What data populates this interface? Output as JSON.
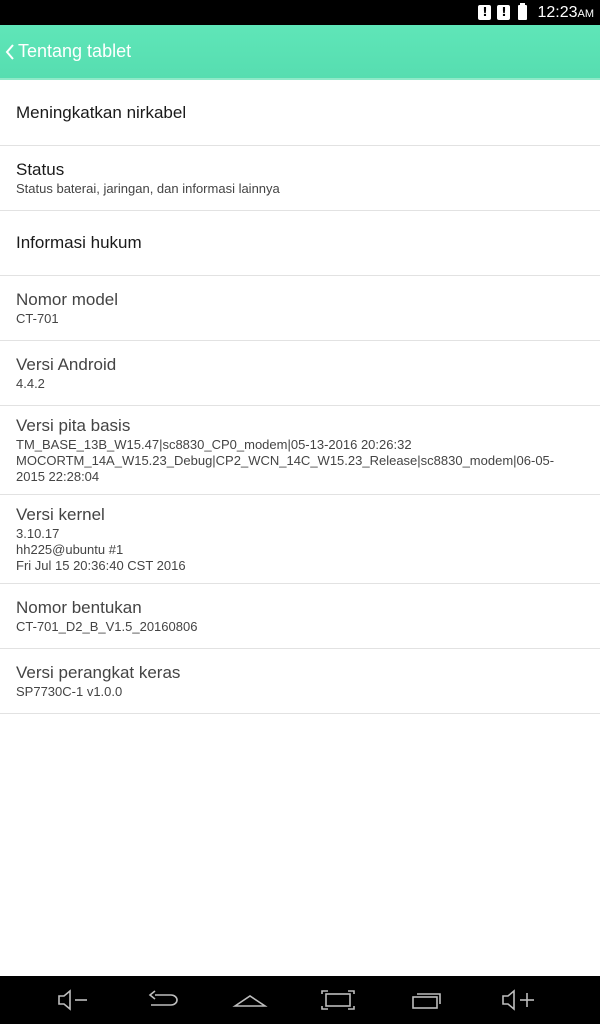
{
  "status_bar": {
    "notifications": [
      "!",
      "!"
    ],
    "time": "12:23",
    "ampm": "AM"
  },
  "action_bar": {
    "title": "Tentang tablet",
    "background": "#5fe6b8"
  },
  "items": [
    {
      "title": "Meningkatkan nirkabel",
      "subtitle": ""
    },
    {
      "title": "Status",
      "subtitle": "Status baterai, jaringan, dan informasi lainnya"
    },
    {
      "title": "Informasi hukum",
      "subtitle": ""
    },
    {
      "title": "Nomor model",
      "subtitle": "CT-701"
    },
    {
      "title": "Versi Android",
      "subtitle": "4.4.2"
    },
    {
      "title": "Versi pita basis",
      "subtitle": "TM_BASE_13B_W15.47|sc8830_CP0_modem|05-13-2016 20:26:32\nMOCORTM_14A_W15.23_Debug|CP2_WCN_14C_W15.23_Release|sc8830_modem|06-05-2015 22:28:04"
    },
    {
      "title": "Versi kernel",
      "subtitle": "3.10.17\nhh225@ubuntu #1\nFri Jul 15 20:36:40 CST 2016"
    },
    {
      "title": "Nomor bentukan",
      "subtitle": "CT-701_D2_B_V1.5_20160806"
    },
    {
      "title": "Versi perangkat keras",
      "subtitle": "SP7730C-1 v1.0.0"
    }
  ],
  "nav_bar": {
    "buttons": [
      "volume-down-icon",
      "back-icon",
      "home-icon",
      "screenshot-icon",
      "recent-apps-icon",
      "volume-up-icon"
    ]
  }
}
